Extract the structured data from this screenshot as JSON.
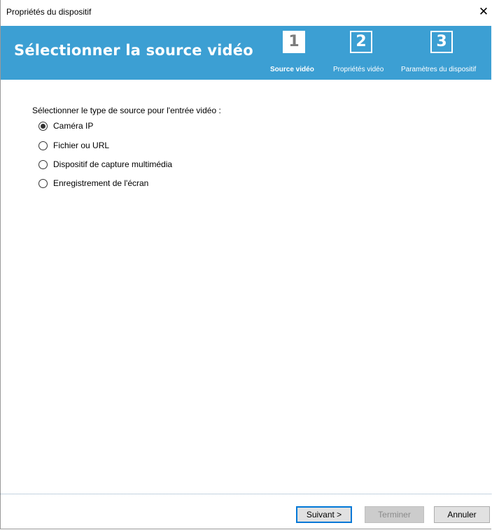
{
  "window": {
    "title": "Propriétés du dispositif",
    "close_glyph": "✕"
  },
  "header": {
    "heading": "Sélectionner la source vidéo",
    "background": "#3c9fd3",
    "steps": [
      {
        "number": "1",
        "label": "Source vidéo",
        "active": true
      },
      {
        "number": "2",
        "label": "Propriétés vidéo",
        "active": false
      },
      {
        "number": "3",
        "label": "Paramètres du dispositif",
        "active": false
      }
    ]
  },
  "content": {
    "prompt": "Sélectionner le type de source pour l'entrée vidéo :",
    "selected": 0,
    "options": [
      {
        "label": "Caméra IP",
        "checked": true
      },
      {
        "label": "Fichier ou URL",
        "checked": false
      },
      {
        "label": "Dispositif de capture multimédia",
        "checked": false
      },
      {
        "label": "Enregistrement de l'écran",
        "checked": false
      }
    ]
  },
  "footer": {
    "next_label": "Suivant >",
    "finish_label": "Terminer",
    "cancel_label": "Annuler"
  }
}
